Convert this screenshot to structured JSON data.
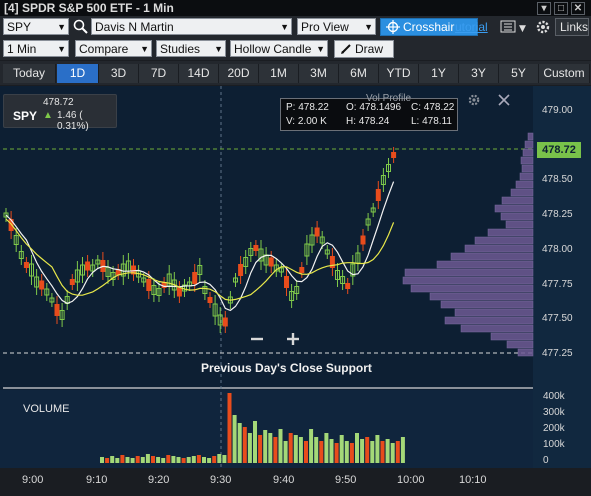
{
  "window": {
    "title": "[4] SPDR S&P 500 ETF - 1 Min",
    "controls": [
      "▾",
      "□",
      "✕"
    ]
  },
  "toolbar1": {
    "symbol": "SPY",
    "account": "Davis N Martin",
    "view": "Pro View",
    "crosshair_label": "Crosshair",
    "tutorial_label": "utorial",
    "links_label": "Links"
  },
  "toolbar2": {
    "interval": "1 Min",
    "compare": "Compare",
    "studies": "Studies",
    "chart_type": "Hollow Candle",
    "draw": "Draw"
  },
  "timeframes": [
    {
      "label": "Today",
      "active": false
    },
    {
      "label": "1D",
      "active": true
    },
    {
      "label": "3D",
      "active": false
    },
    {
      "label": "7D",
      "active": false
    },
    {
      "label": "14D",
      "active": false
    },
    {
      "label": "20D",
      "active": false
    },
    {
      "label": "1M",
      "active": false
    },
    {
      "label": "3M",
      "active": false
    },
    {
      "label": "6M",
      "active": false
    },
    {
      "label": "YTD",
      "active": false
    },
    {
      "label": "1Y",
      "active": false
    },
    {
      "label": "3Y",
      "active": false
    },
    {
      "label": "5Y",
      "active": false
    },
    {
      "label": "Custom",
      "active": false
    }
  ],
  "quote": {
    "symbol": "SPY",
    "price": "478.72",
    "change": "1.46 ( 0.31%)"
  },
  "ohlc": {
    "p": "P: 478.22",
    "o": "O: 478.1496",
    "c": "C: 478.22",
    "v": "V: 2.00 K",
    "h": "H: 478.24",
    "l": "L: 478.11"
  },
  "vol_profile_label": "Vol Profile",
  "last_price_tag": "478.72",
  "support_label": "Previous Day's Close Support",
  "volume_label": "VOLUME",
  "price_axis": [
    "479.00",
    "478.75",
    "478.50",
    "478.25",
    "478.00",
    "477.75",
    "477.50",
    "477.25"
  ],
  "volume_axis": [
    "400k",
    "300k",
    "200k",
    "100k",
    "0"
  ],
  "time_axis": [
    "9:00",
    "9:10",
    "9:20",
    "9:30",
    "9:40",
    "9:50",
    "10:00",
    "10:10"
  ],
  "colors": {
    "up": "#7fc94a",
    "down": "#e84c1c",
    "ma_yellow": "#e8e84a",
    "ma_white": "#f2f2f2",
    "last_price": "#79c24a",
    "profile": "#6e5a94",
    "background": "#0d1f33"
  }
}
